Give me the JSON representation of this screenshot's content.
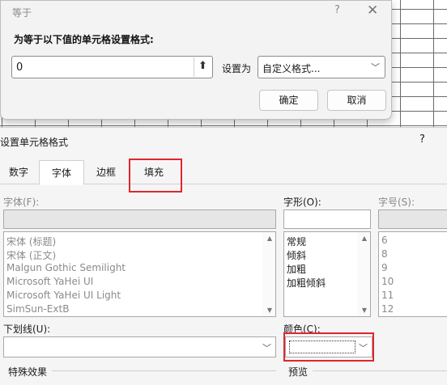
{
  "eq_dialog": {
    "title": "等于",
    "help": "?",
    "heading": "为等于以下值的单元格设置格式:",
    "value": "0",
    "collapse_icon": "⬆",
    "set_as_label": "设置为",
    "format_value": "自定义格式...",
    "ok_label": "确定",
    "cancel_label": "取消"
  },
  "format_dialog": {
    "title": "设置单元格格式",
    "help": "?",
    "tabs": [
      {
        "label": "数字"
      },
      {
        "label": "字体"
      },
      {
        "label": "边框"
      },
      {
        "label": "填充"
      }
    ],
    "font_label": "字体(F):",
    "font_items": [
      {
        "label": "宋体 (标题)"
      },
      {
        "label": "宋体 (正文)"
      },
      {
        "label": "Malgun Gothic Semilight"
      },
      {
        "label": "Microsoft YaHei UI"
      },
      {
        "label": "Microsoft YaHei UI Light"
      },
      {
        "label": "SimSun-ExtB"
      }
    ],
    "style_label": "字形(O):",
    "style_items": [
      {
        "label": "常规"
      },
      {
        "label": "倾斜"
      },
      {
        "label": "加粗"
      },
      {
        "label": "加粗倾斜"
      }
    ],
    "size_label": "字号(S):",
    "size_items": [
      {
        "label": "6"
      },
      {
        "label": "8"
      },
      {
        "label": "9"
      },
      {
        "label": "10"
      },
      {
        "label": "11"
      },
      {
        "label": "12"
      }
    ],
    "underline_label": "下划线(U):",
    "color_label": "颜色(C):",
    "effects_label": "特殊效果",
    "preview_label": "预览"
  },
  "colors": {
    "highlight_red": "#e0262c",
    "dialog_bg": "#f3f3f3"
  }
}
